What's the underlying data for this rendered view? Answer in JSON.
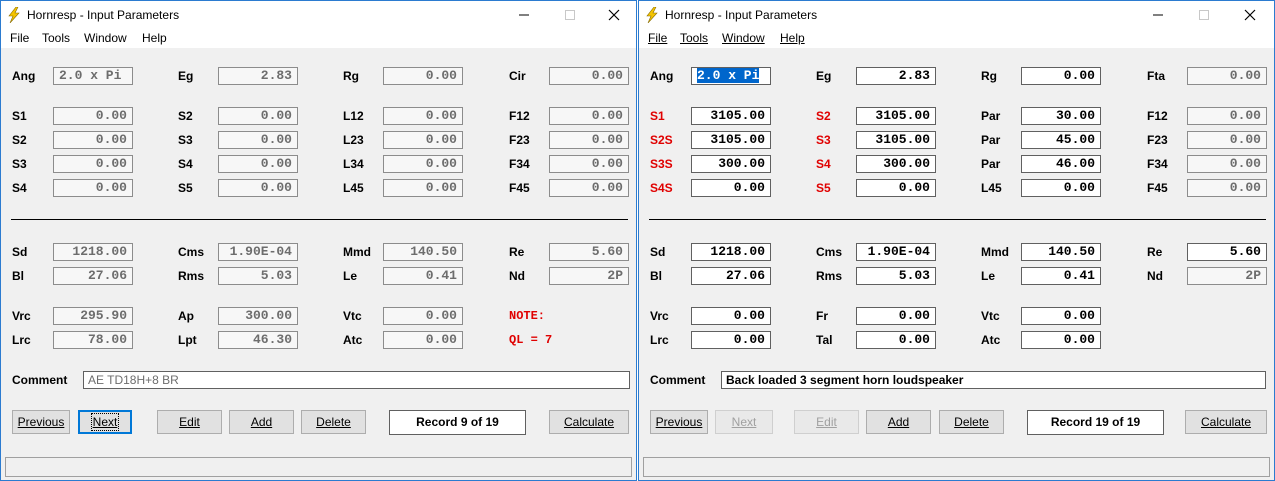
{
  "windows": [
    {
      "title": "Hornresp - Input Parameters",
      "menu": [
        "File",
        "Tools",
        "Window",
        "Help"
      ],
      "labels": {
        "r1": [
          "Ang",
          "Eg",
          "Rg",
          "Cir"
        ],
        "r2": [
          "S1",
          "S2",
          "L12",
          "F12"
        ],
        "r3": [
          "S2",
          "S3",
          "L23",
          "F23"
        ],
        "r4": [
          "S3",
          "S4",
          "L34",
          "F34"
        ],
        "r5": [
          "S4",
          "S5",
          "L45",
          "F45"
        ],
        "r6": [
          "Sd",
          "Cms",
          "Mmd",
          "Re"
        ],
        "r7": [
          "Bl",
          "Rms",
          "Le",
          "Nd"
        ],
        "r8": [
          "Vrc",
          "Ap",
          "Vtc"
        ],
        "r9": [
          "Lrc",
          "Lpt",
          "Atc"
        ]
      },
      "values": {
        "r1": [
          "2.0 x Pi",
          "2.83",
          "0.00",
          "0.00"
        ],
        "r2": [
          "0.00",
          "0.00",
          "0.00",
          "0.00"
        ],
        "r3": [
          "0.00",
          "0.00",
          "0.00",
          "0.00"
        ],
        "r4": [
          "0.00",
          "0.00",
          "0.00",
          "0.00"
        ],
        "r5": [
          "0.00",
          "0.00",
          "0.00",
          "0.00"
        ],
        "r6": [
          "1218.00",
          "1.90E-04",
          "140.50",
          "5.60"
        ],
        "r7": [
          "27.06",
          "5.03",
          "0.41",
          "2P"
        ],
        "r8": [
          "295.90",
          "300.00",
          "0.00"
        ],
        "r9": [
          "78.00",
          "46.30",
          "0.00"
        ]
      },
      "note": [
        "NOTE:",
        "QL = 7"
      ],
      "comment_label": "Comment",
      "comment": "AE TD18H+8 BR",
      "buttons": [
        "Previous",
        "Next",
        "Edit",
        "Add",
        "Delete",
        "Calculate"
      ],
      "record": "Record 9 of 19"
    },
    {
      "title": "Hornresp - Input Parameters",
      "menu": [
        "File",
        "Tools",
        "Window",
        "Help"
      ],
      "labels": {
        "r1": [
          "Ang",
          "Eg",
          "Rg",
          "Fta"
        ],
        "r2": [
          "S1",
          "S2",
          "Par",
          "F12"
        ],
        "r3": [
          "S2S",
          "S3",
          "Par",
          "F23"
        ],
        "r4": [
          "S3S",
          "S4",
          "Par",
          "F34"
        ],
        "r5": [
          "S4S",
          "S5",
          "L45",
          "F45"
        ],
        "r6": [
          "Sd",
          "Cms",
          "Mmd",
          "Re"
        ],
        "r7": [
          "Bl",
          "Rms",
          "Le",
          "Nd"
        ],
        "r8": [
          "Vrc",
          "Fr",
          "Vtc"
        ],
        "r9": [
          "Lrc",
          "Tal",
          "Atc"
        ]
      },
      "values": {
        "r1": [
          "2.0 x Pi",
          "2.83",
          "0.00",
          "0.00"
        ],
        "r2": [
          "3105.00",
          "3105.00",
          "30.00",
          "0.00"
        ],
        "r3": [
          "3105.00",
          "3105.00",
          "45.00",
          "0.00"
        ],
        "r4": [
          "300.00",
          "300.00",
          "46.00",
          "0.00"
        ],
        "r5": [
          "0.00",
          "0.00",
          "0.00",
          "0.00"
        ],
        "r6": [
          "1218.00",
          "1.90E-04",
          "140.50",
          "5.60"
        ],
        "r7": [
          "27.06",
          "5.03",
          "0.41",
          "2P"
        ],
        "r8": [
          "0.00",
          "0.00",
          "0.00"
        ],
        "r9": [
          "0.00",
          "0.00",
          "0.00"
        ]
      },
      "comment_label": "Comment",
      "comment": "Back loaded 3 segment horn loudspeaker",
      "buttons": [
        "Previous",
        "Next",
        "Edit",
        "Add",
        "Delete",
        "Calculate"
      ],
      "record": "Record 19 of 19"
    }
  ],
  "colors": {
    "accent": "#0078d7",
    "label_red": "#e00000",
    "selection": "#0066cc",
    "icon": "#f5c400"
  },
  "icons": [
    "lightning-app-icon",
    "minimize-icon",
    "maximize-icon",
    "close-icon"
  ]
}
